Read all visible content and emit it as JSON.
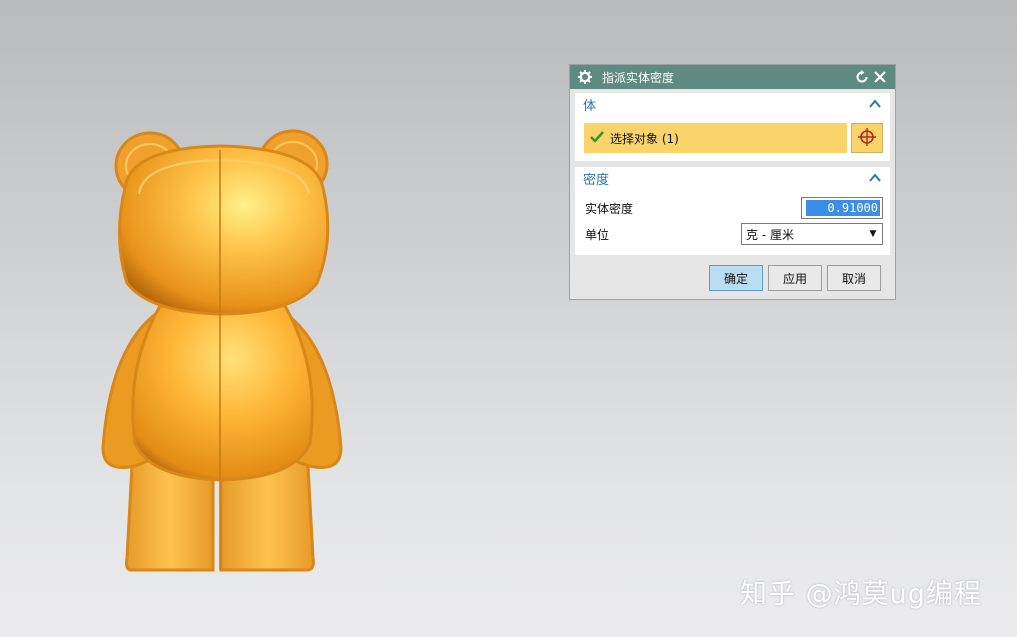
{
  "dialog": {
    "title": "指派实体密度",
    "body_group": {
      "title": "体",
      "select_label": "选择对象 (1)"
    },
    "density_group": {
      "title": "密度",
      "density_label": "实体密度",
      "density_value": "0.91000",
      "unit_label": "单位",
      "unit_value": "克 - 厘米"
    },
    "buttons": {
      "ok": "确定",
      "apply": "应用",
      "cancel": "取消"
    }
  },
  "watermark": "知乎 @鸿莫ug编程",
  "colors": {
    "titlebar": "#5f8a81",
    "group_title": "#2a77a8",
    "selection_highlight": "#fad46b",
    "input_highlight": "#3a8ee6",
    "model_orange": "#f5a623"
  },
  "icons": {
    "settings": "gear-icon",
    "reset": "reset-icon",
    "close": "close-icon",
    "collapse": "chevron-up-icon",
    "checked": "check-icon",
    "point_select": "crosshair-icon",
    "dropdown": "chevron-down-icon"
  }
}
